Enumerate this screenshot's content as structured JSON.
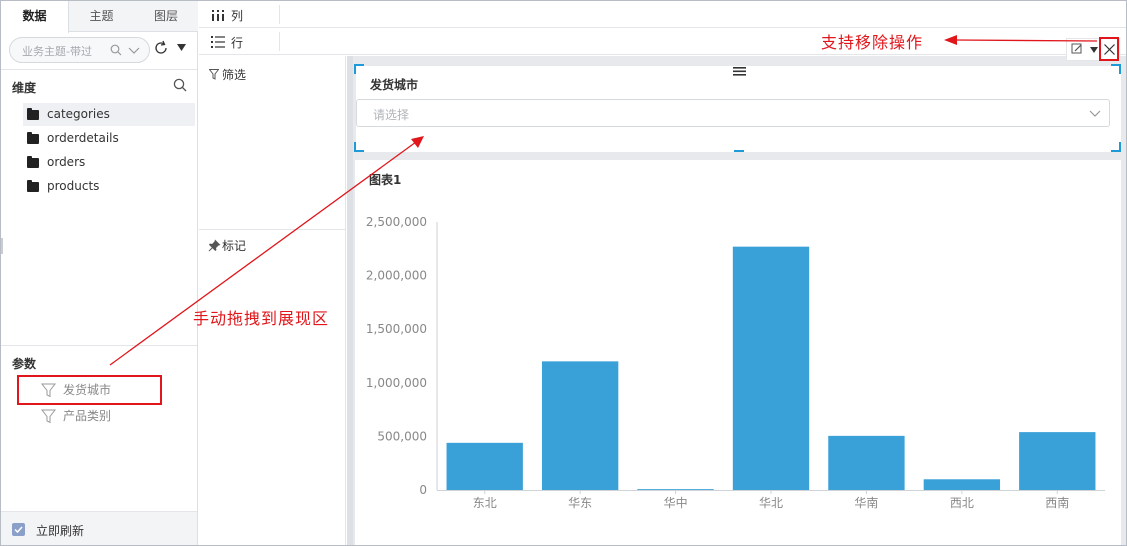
{
  "left_panel": {
    "tabs": [
      {
        "label": "数据",
        "active": true
      },
      {
        "label": "主题",
        "active": false
      },
      {
        "label": "图层",
        "active": false
      }
    ],
    "search_placeholder": "业务主题-带过",
    "dimension_title": "维度",
    "dimensions": [
      "categories",
      "orderdetails",
      "orders",
      "products"
    ],
    "params_title": "参数",
    "params": [
      "发货城市",
      "产品类别"
    ],
    "refresh_label": "立即刷新"
  },
  "shelf": {
    "columns_label": "列",
    "rows_label": "行",
    "filter_label": "筛选",
    "mark_label": "标记"
  },
  "filter_widget": {
    "title": "发货城市",
    "placeholder": "请选择"
  },
  "chart_panel": {
    "title": "图表1"
  },
  "annotations": {
    "remove_hint": "支持移除操作",
    "drag_hint": "手动拖拽到展现区"
  },
  "colors": {
    "bar": "#3aa0d8",
    "annotation": "#e0161b",
    "selection": "#1e9bd7"
  },
  "chart_data": {
    "type": "bar",
    "title": "图表1",
    "categories": [
      "东北",
      "华东",
      "华中",
      "华北",
      "华南",
      "西北",
      "西南"
    ],
    "values": [
      440000,
      1200000,
      8000,
      2270000,
      505000,
      100000,
      540000
    ],
    "ylim": [
      0,
      2500000
    ],
    "yticks": [
      0,
      500000,
      1000000,
      1500000,
      2000000,
      2500000
    ],
    "ytick_labels": [
      "0",
      "500,000",
      "1,000,000",
      "1,500,000",
      "2,000,000",
      "2,500,000"
    ],
    "grid": false,
    "legend": "none"
  }
}
